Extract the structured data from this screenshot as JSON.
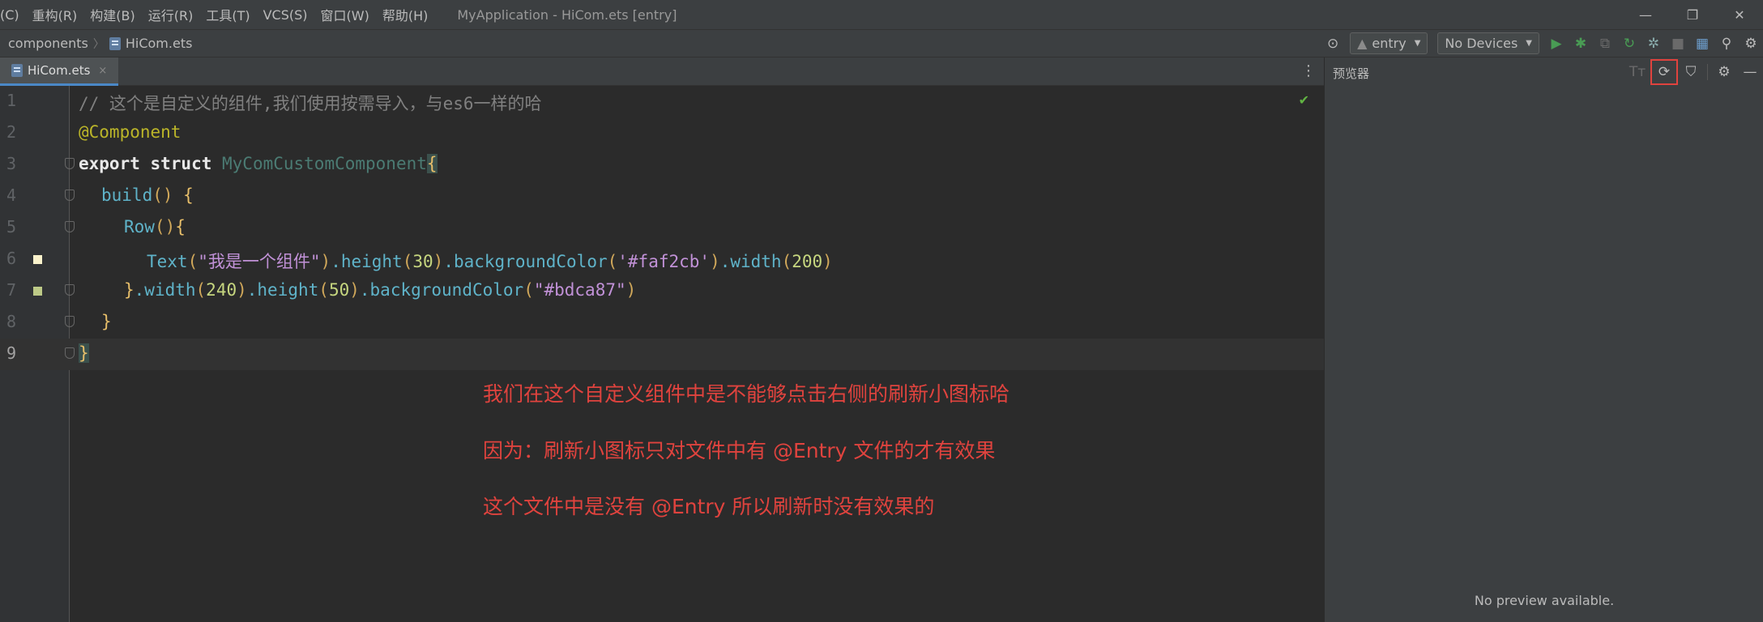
{
  "menu": {
    "items": [
      "(C)",
      "重构(R)",
      "构建(B)",
      "运行(R)",
      "工具(T)",
      "VCS(S)",
      "窗口(W)",
      "帮助(H)"
    ],
    "window_title": "MyApplication - HiCom.ets [entry]"
  },
  "window_controls": {
    "minimize": "—",
    "restore": "❐",
    "close": "✕"
  },
  "breadcrumb": {
    "folder": "components",
    "file": "HiCom.ets"
  },
  "toolbar": {
    "module": "entry",
    "device": "No Devices"
  },
  "editor_tab": {
    "label": "HiCom.ets",
    "close": "×"
  },
  "code_lines": [
    {
      "num": "1",
      "text": "// 这个是自定义的组件,我们使用按需导入，与es6一样的哈"
    },
    {
      "num": "2",
      "text": "@Component"
    },
    {
      "num": "3",
      "kw": "export struct ",
      "cls": "MyComCustomComponent",
      "brace": "{"
    },
    {
      "num": "4",
      "fn": "build",
      "par": "() ",
      "brace": "{"
    },
    {
      "num": "5",
      "fn": "Row",
      "par": "()",
      "brace": "{"
    },
    {
      "num": "6",
      "fn": "Text",
      "p1": "(",
      "str": "\"我是一个组件\"",
      "p2": ")",
      "m1": ".height",
      "p3": "(",
      "n1": "30",
      "p4": ")",
      "m2": ".backgroundColor",
      "p5": "(",
      "s2": "'#faf2cb'",
      "p6": ")",
      "m3": ".width",
      "p7": "(",
      "n2": "200",
      "p8": ")"
    },
    {
      "num": "7",
      "brace": "}",
      "m1": ".width",
      "p1": "(",
      "n1": "240",
      "p2": ")",
      "m2": ".height",
      "p3": "(",
      "n2": "50",
      "p4": ")",
      "m3": ".backgroundColor",
      "p5": "(",
      "s1": "\"#bdca87\"",
      "p6": ")"
    },
    {
      "num": "8",
      "brace": "}"
    },
    {
      "num": "9",
      "brace": "}"
    }
  ],
  "gutter_marks": {
    "line6": "#faf2cb",
    "line7": "#bdca87"
  },
  "annotations": [
    "我们在这个自定义组件中是不能够点击右侧的刷新小图标哈",
    "因为：刷新小图标只对文件中有 @Entry 文件的才有效果",
    "这个文件中是没有 @Entry 所以刷新时没有效果的"
  ],
  "preview": {
    "title": "预览器",
    "empty_text": "No preview available."
  },
  "colors": {
    "annotation": "#e0433e",
    "highlight_box": "#e0433e"
  }
}
